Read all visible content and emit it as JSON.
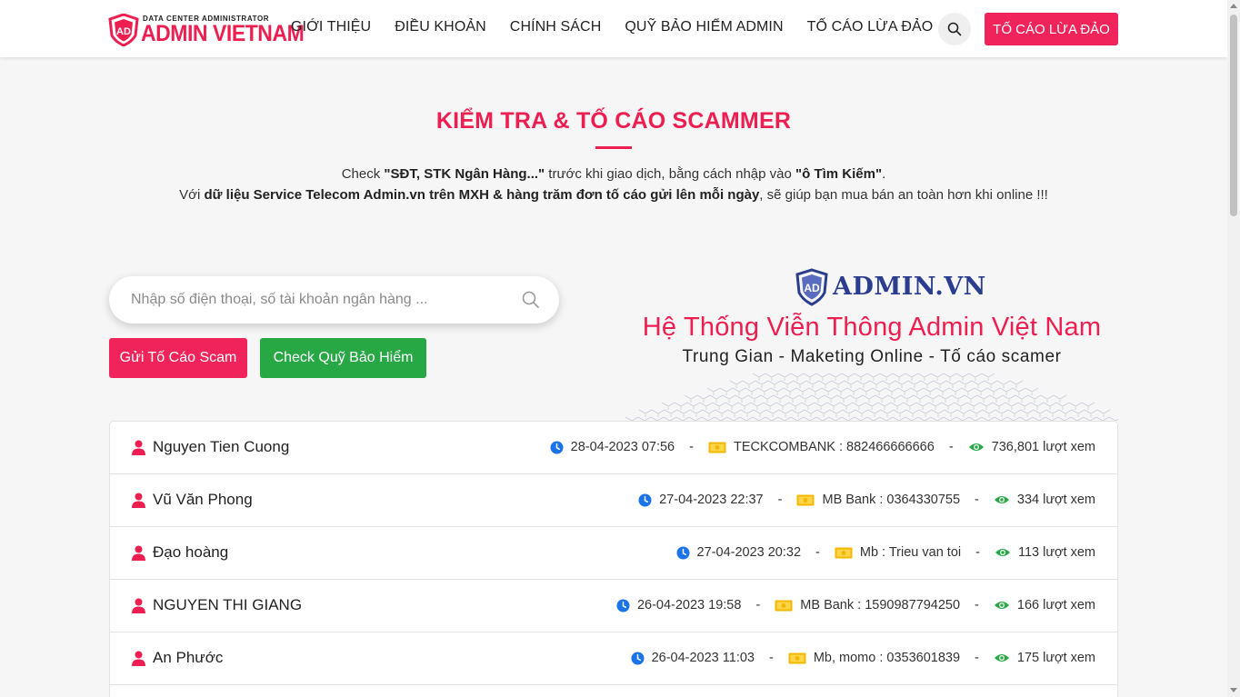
{
  "header": {
    "logo_small": "DATA CENTER ADMINISTRATOR",
    "logo_big": "ADMIN VIETNAM",
    "logo_shield": "AD",
    "nav": [
      "GIỚI THIỆU",
      "ĐIỀU KHOẢN",
      "CHÍNH SÁCH",
      "QUỸ BẢO HIỂM ADMIN",
      "TỐ CÁO LỪA ĐẢO"
    ],
    "report_button": "TỐ CÁO LỪA ĐẢO"
  },
  "hero": {
    "title": "KIỂM TRA & TỐ CÁO SCAMMER",
    "line1_pre": "Check ",
    "line1_bold1": "\"SĐT, STK Ngân Hàng...\"",
    "line1_mid": " trước khi giao dịch, bằng cách nhập vào ",
    "line1_bold2": "\"ô Tìm Kiếm\"",
    "line1_post": ".",
    "line2_pre": "Với ",
    "line2_bold": "dữ liệu Service Telecom Admin.vn trên MXH & hàng trăm đơn tố cáo gửi lên mỗi ngày",
    "line2_post": ", sẽ giúp bạn mua bán an toàn hơn khi online !!!"
  },
  "search": {
    "placeholder": "Nhập số điện thoại, số tài khoản ngân hàng ...",
    "value": ""
  },
  "actions": {
    "report_scam": "Gửi Tố Cáo Scam",
    "check_fund": "Check Quỹ Bảo Hiểm"
  },
  "banner": {
    "brand": "ADMIN.VN",
    "title": "Hệ Thống Viễn Thông Admin Việt Nam",
    "subtitle": "Trung Gian - Maketing Online - Tố cáo scamer"
  },
  "reports": [
    {
      "name": "Nguyen Tien Cuong",
      "date": "28-04-2023 07:56",
      "account": "TECKCOMBANK : 882466666666",
      "views": "736,801 lượt xem"
    },
    {
      "name": "Vũ Văn Phong",
      "date": "27-04-2023 22:37",
      "account": "MB Bank : 0364330755",
      "views": "334 lượt xem"
    },
    {
      "name": "Đạo hoàng",
      "date": "27-04-2023 20:32",
      "account": "Mb : Trieu van toi",
      "views": "113 lượt xem"
    },
    {
      "name": "NGUYEN THI GIANG",
      "date": "26-04-2023 19:58",
      "account": "MB Bank : 1590987794250",
      "views": "166 lượt xem"
    },
    {
      "name": "An Phước",
      "date": "26-04-2023 11:03",
      "account": "Mb, momo : 0353601839",
      "views": "175 lượt xem"
    }
  ],
  "colors": {
    "accent": "#f0245a",
    "green": "#28a745",
    "clock": "#1a73e8",
    "money": "#f5b800",
    "eye": "#28a745",
    "brand_blue": "#2b3d8f"
  },
  "icons": [
    "search-icon",
    "user-icon",
    "clock-icon",
    "money-icon",
    "eye-icon",
    "shield-logo-icon"
  ]
}
